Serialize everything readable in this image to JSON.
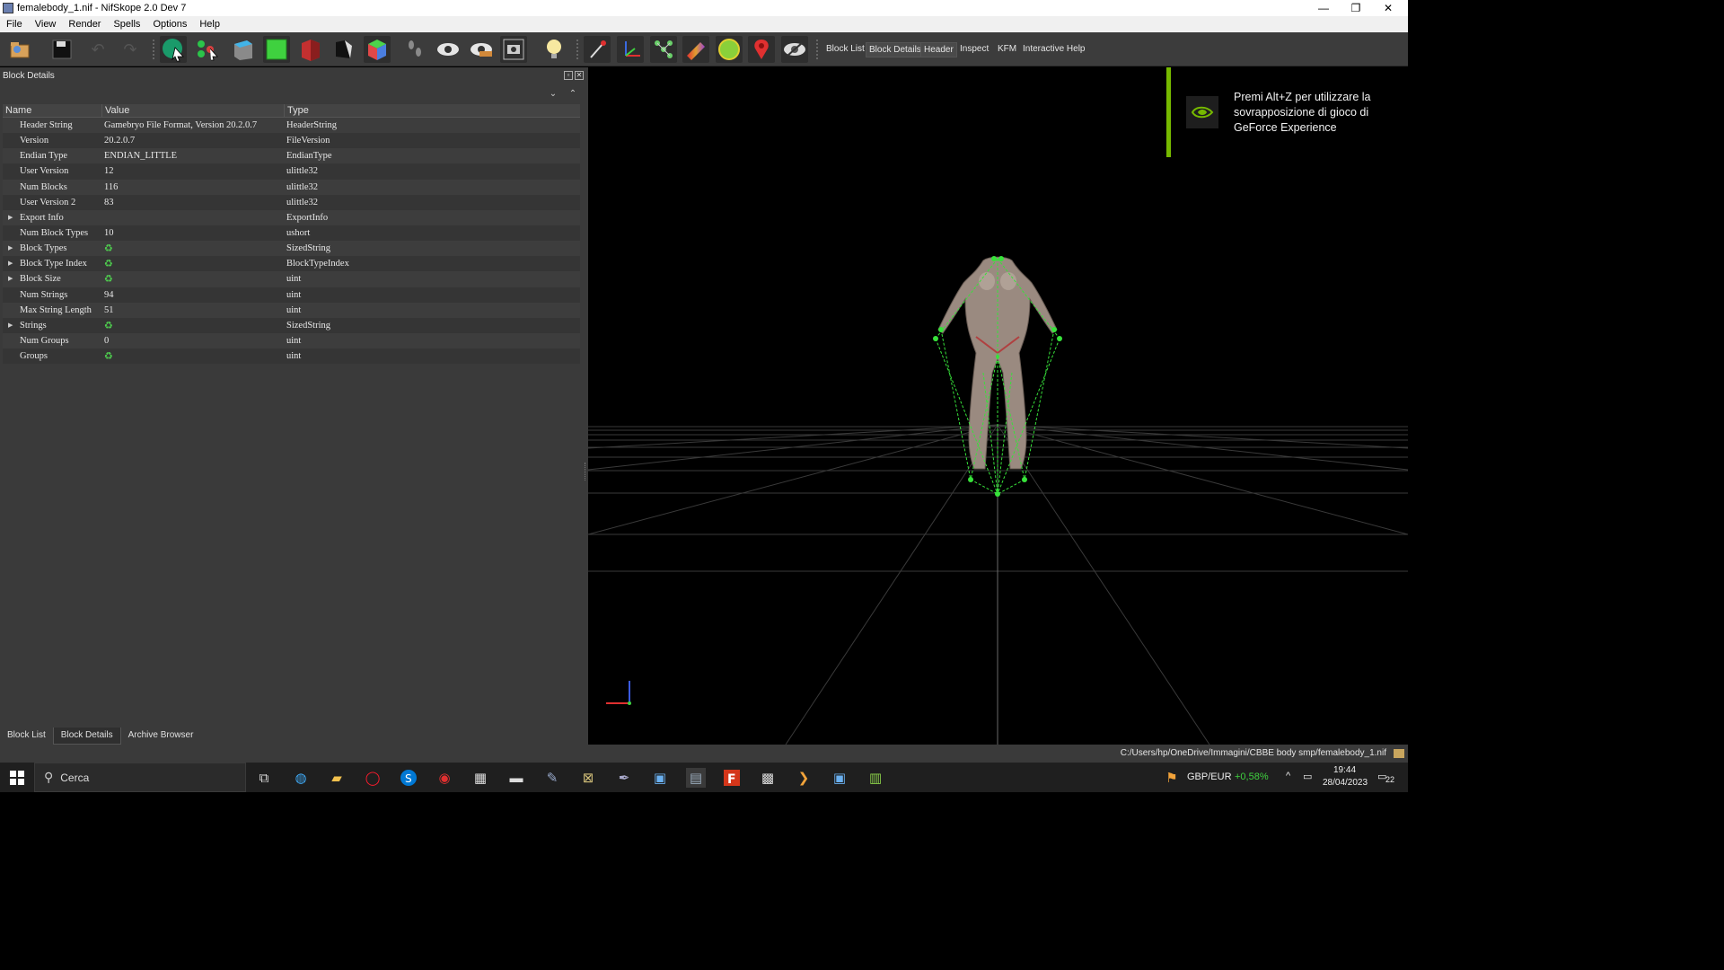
{
  "window": {
    "title": "femalebody_1.nif - NifSkope 2.0 Dev 7",
    "controls": [
      "minimize-icon",
      "restore-icon",
      "close-icon"
    ]
  },
  "menu": [
    "File",
    "View",
    "Render",
    "Spells",
    "Options",
    "Help"
  ],
  "toolbar": {
    "icons": [
      "open-icon",
      "save-icon",
      "undo-icon",
      "redo-icon",
      "select-object-icon",
      "select-node-icon",
      "flat-shading-icon",
      "green-cube-icon",
      "red-cube-icon",
      "half-shade-icon",
      "color-cube-icon",
      "footprints-icon",
      "eye-icon",
      "eye-toggle-icon",
      "screenshot-icon",
      "light-bulb-icon",
      "marker-icon",
      "axes-icon",
      "nodes-icon",
      "gradient-icon",
      "globe-icon",
      "location-pin-icon",
      "hidden-eye-icon"
    ],
    "docks": [
      "Block List",
      "Block Details",
      "Header",
      "Inspect",
      "KFM",
      "Interactive Help"
    ]
  },
  "block_details": {
    "title": "Block Details",
    "columns": [
      "Name",
      "Value",
      "Type"
    ],
    "rows": [
      {
        "name": "Header String",
        "value": "Gamebryo File Format, Version 20.2.0.7",
        "type": "HeaderString",
        "expandable": false,
        "refresh": false
      },
      {
        "name": "Version",
        "value": "20.2.0.7",
        "type": "FileVersion",
        "expandable": false,
        "refresh": false
      },
      {
        "name": "Endian Type",
        "value": "ENDIAN_LITTLE",
        "type": "EndianType",
        "expandable": false,
        "refresh": false
      },
      {
        "name": "User Version",
        "value": "12",
        "type": "ulittle32",
        "expandable": false,
        "refresh": false
      },
      {
        "name": "Num Blocks",
        "value": "116",
        "type": "ulittle32",
        "expandable": false,
        "refresh": false
      },
      {
        "name": "User Version 2",
        "value": "83",
        "type": "ulittle32",
        "expandable": false,
        "refresh": false
      },
      {
        "name": "Export Info",
        "value": "",
        "type": "ExportInfo",
        "expandable": true,
        "refresh": false
      },
      {
        "name": "Num Block Types",
        "value": "10",
        "type": "ushort",
        "expandable": false,
        "refresh": false
      },
      {
        "name": "Block Types",
        "value": "",
        "type": "SizedString",
        "expandable": true,
        "refresh": true
      },
      {
        "name": "Block Type Index",
        "value": "",
        "type": "BlockTypeIndex",
        "expandable": true,
        "refresh": true
      },
      {
        "name": "Block Size",
        "value": "",
        "type": "uint",
        "expandable": true,
        "refresh": true
      },
      {
        "name": "Num Strings",
        "value": "94",
        "type": "uint",
        "expandable": false,
        "refresh": false
      },
      {
        "name": "Max String Length",
        "value": "51",
        "type": "uint",
        "expandable": false,
        "refresh": false
      },
      {
        "name": "Strings",
        "value": "",
        "type": "SizedString",
        "expandable": true,
        "refresh": true
      },
      {
        "name": "Num Groups",
        "value": "0",
        "type": "uint",
        "expandable": false,
        "refresh": false
      },
      {
        "name": "Groups",
        "value": "",
        "type": "uint",
        "expandable": false,
        "refresh": true
      }
    ]
  },
  "bottom_tabs": [
    "Block List",
    "Block Details",
    "Archive Browser"
  ],
  "active_bottom_tab": "Block Details",
  "overlay": {
    "text": "Premi Alt+Z per utilizzare la sovrapposizione di gioco di GeForce Experience",
    "accent": "#76b900"
  },
  "status": {
    "path": "C:/Users/hp/OneDrive/Immagini/CBBE body smp/femalebody_1.nif"
  },
  "taskbar": {
    "search_placeholder": "Cerca",
    "apps": [
      "task-view-icon",
      "edge-icon",
      "file-explorer-icon",
      "opera-icon",
      "skype-icon",
      "record-icon",
      "game-icon",
      "mmw-icon",
      "paint-icon",
      "nvidia-k-icon",
      "pen-icon",
      "window-icon",
      "nifskope-icon",
      "f-app-icon",
      "counter-app-icon",
      "chevron-app-icon",
      "store-icon",
      "chart-app-icon"
    ],
    "currency": "GBP/EUR",
    "currency_change": "+0,58%",
    "time": "19:44",
    "date": "28/04/2023",
    "notifications": "22"
  },
  "colors": {
    "panel_bg": "#3a3a3a",
    "refresh_green": "#4fd14f",
    "bone_green": "#37e23a"
  }
}
